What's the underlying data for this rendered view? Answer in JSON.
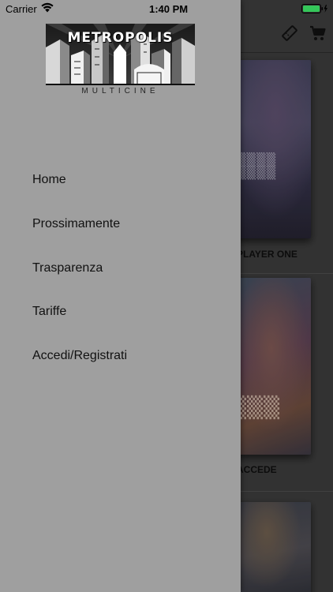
{
  "status_bar": {
    "carrier": "Carrier",
    "time": "1:40 PM",
    "wifi_icon": "wifi-icon",
    "battery_icon": "battery-icon",
    "battery_color": "#34c759"
  },
  "drawer": {
    "logo": {
      "wordmark": "METROPOLIS",
      "subtitle": "MULTICINE"
    },
    "menu_items": [
      {
        "label": "Home"
      },
      {
        "label": "Prossimamente"
      },
      {
        "label": "Trasparenza"
      },
      {
        "label": "Tariffe"
      },
      {
        "label": "Accedi/Registrati"
      }
    ],
    "background_color": "#9f9f9f"
  },
  "background": {
    "toolbar_icons": [
      "ticket-icon",
      "cart-icon"
    ],
    "movies": [
      {
        "title": "PLAYER ONE"
      },
      {
        "title": "ACCEDE"
      }
    ]
  }
}
